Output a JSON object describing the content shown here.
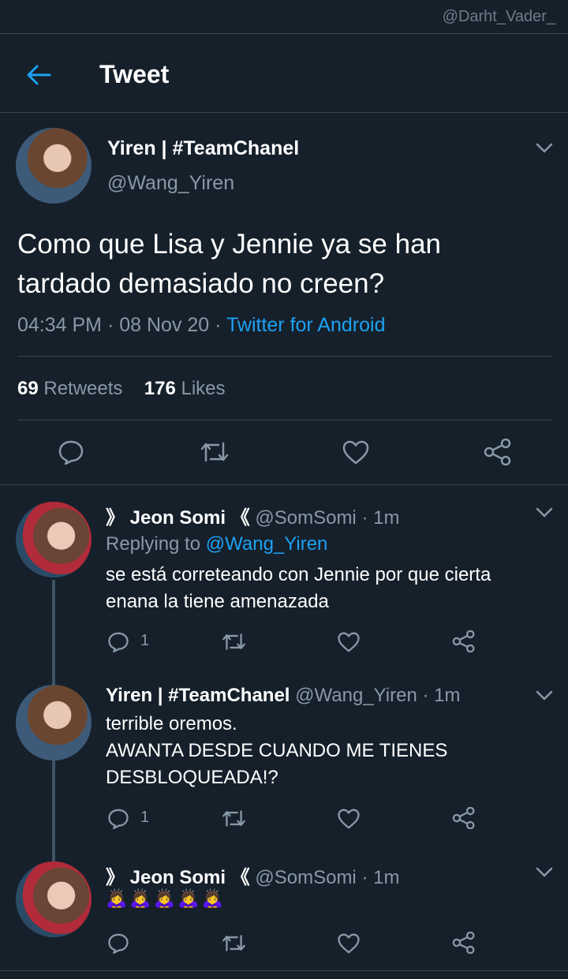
{
  "watermark": "@Darht_Vader_",
  "header": {
    "title": "Tweet"
  },
  "main_tweet": {
    "display_name": "Yiren | #TeamChanel",
    "handle": "@Wang_Yiren",
    "text_line1": "Como que Lisa y Jennie ya se han",
    "text_line2": "tardado demasiado no creen?",
    "time": "04:34 PM",
    "date": "08 Nov 20",
    "source": "Twitter for Android",
    "retweets_count": "69",
    "retweets_label": "Retweets",
    "likes_count": "176",
    "likes_label": "Likes"
  },
  "replies": [
    {
      "name_prefix": "》",
      "display_name": "Jeon Somi",
      "name_suffix": "《",
      "handle": "@SomSomi",
      "time": "1m",
      "replying_label": "Replying to",
      "replying_handle": "@Wang_Yiren",
      "text_line1": "se está correteando con Jennie por que cierta",
      "text_line2": "enana la tiene amenazada",
      "reply_count": "1"
    },
    {
      "display_name": "Yiren | #TeamChanel",
      "handle": "@Wang_Yiren",
      "time": "1m",
      "text_line1": "terrible oremos.",
      "text_line2": "AWANTA DESDE CUANDO ME TIENES",
      "text_line3": "DESBLOQUEADA!?",
      "reply_count": "1"
    },
    {
      "name_prefix": "》",
      "display_name": "Jeon Somi",
      "name_suffix": "《",
      "handle": "@SomSomi",
      "time": "1m",
      "emoji": "🙇‍♀️🙇‍♀️🙇‍♀️🙇‍♀️🙇‍♀️"
    }
  ],
  "separator": "·",
  "colors": {
    "background": "#15202b",
    "accent": "#1da1f2",
    "muted": "#8899a6",
    "divider": "#38444d"
  },
  "icons": [
    "back-arrow-icon",
    "chevron-down-icon",
    "reply-icon",
    "retweet-icon",
    "like-icon",
    "share-icon"
  ]
}
